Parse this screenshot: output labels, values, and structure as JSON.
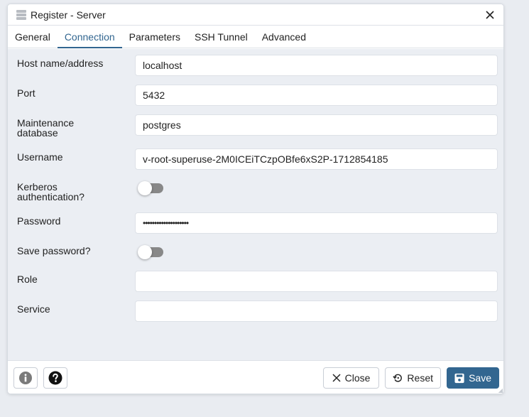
{
  "dialog": {
    "title": "Register - Server",
    "icon": "server-icon",
    "close_icon": "close-icon"
  },
  "tabs": [
    {
      "label": "General",
      "active": false
    },
    {
      "label": "Connection",
      "active": true
    },
    {
      "label": "Parameters",
      "active": false
    },
    {
      "label": "SSH Tunnel",
      "active": false
    },
    {
      "label": "Advanced",
      "active": false
    }
  ],
  "form": {
    "host": {
      "label": "Host name/address",
      "value": "localhost"
    },
    "port": {
      "label": "Port",
      "value": "5432"
    },
    "maintenance_db": {
      "label_line1": "Maintenance",
      "label_line2": "database",
      "value": "postgres"
    },
    "username": {
      "label": "Username",
      "value": "v-root-superuse-2M0ICEiTCzpOBfe6xS2P-1712854185"
    },
    "kerberos": {
      "label_line1": "Kerberos",
      "label_line2": "authentication?",
      "enabled": false
    },
    "password": {
      "label": "Password",
      "value": "••••••••••••••••••••"
    },
    "save_password": {
      "label": "Save password?",
      "enabled": false
    },
    "role": {
      "label": "Role",
      "value": ""
    },
    "service": {
      "label": "Service",
      "value": ""
    }
  },
  "footer": {
    "info_icon": "info-icon",
    "help_icon": "help-icon",
    "close_label": "Close",
    "reset_label": "Reset",
    "save_label": "Save"
  },
  "colors": {
    "accent": "#326690",
    "background": "#ebeef3"
  }
}
